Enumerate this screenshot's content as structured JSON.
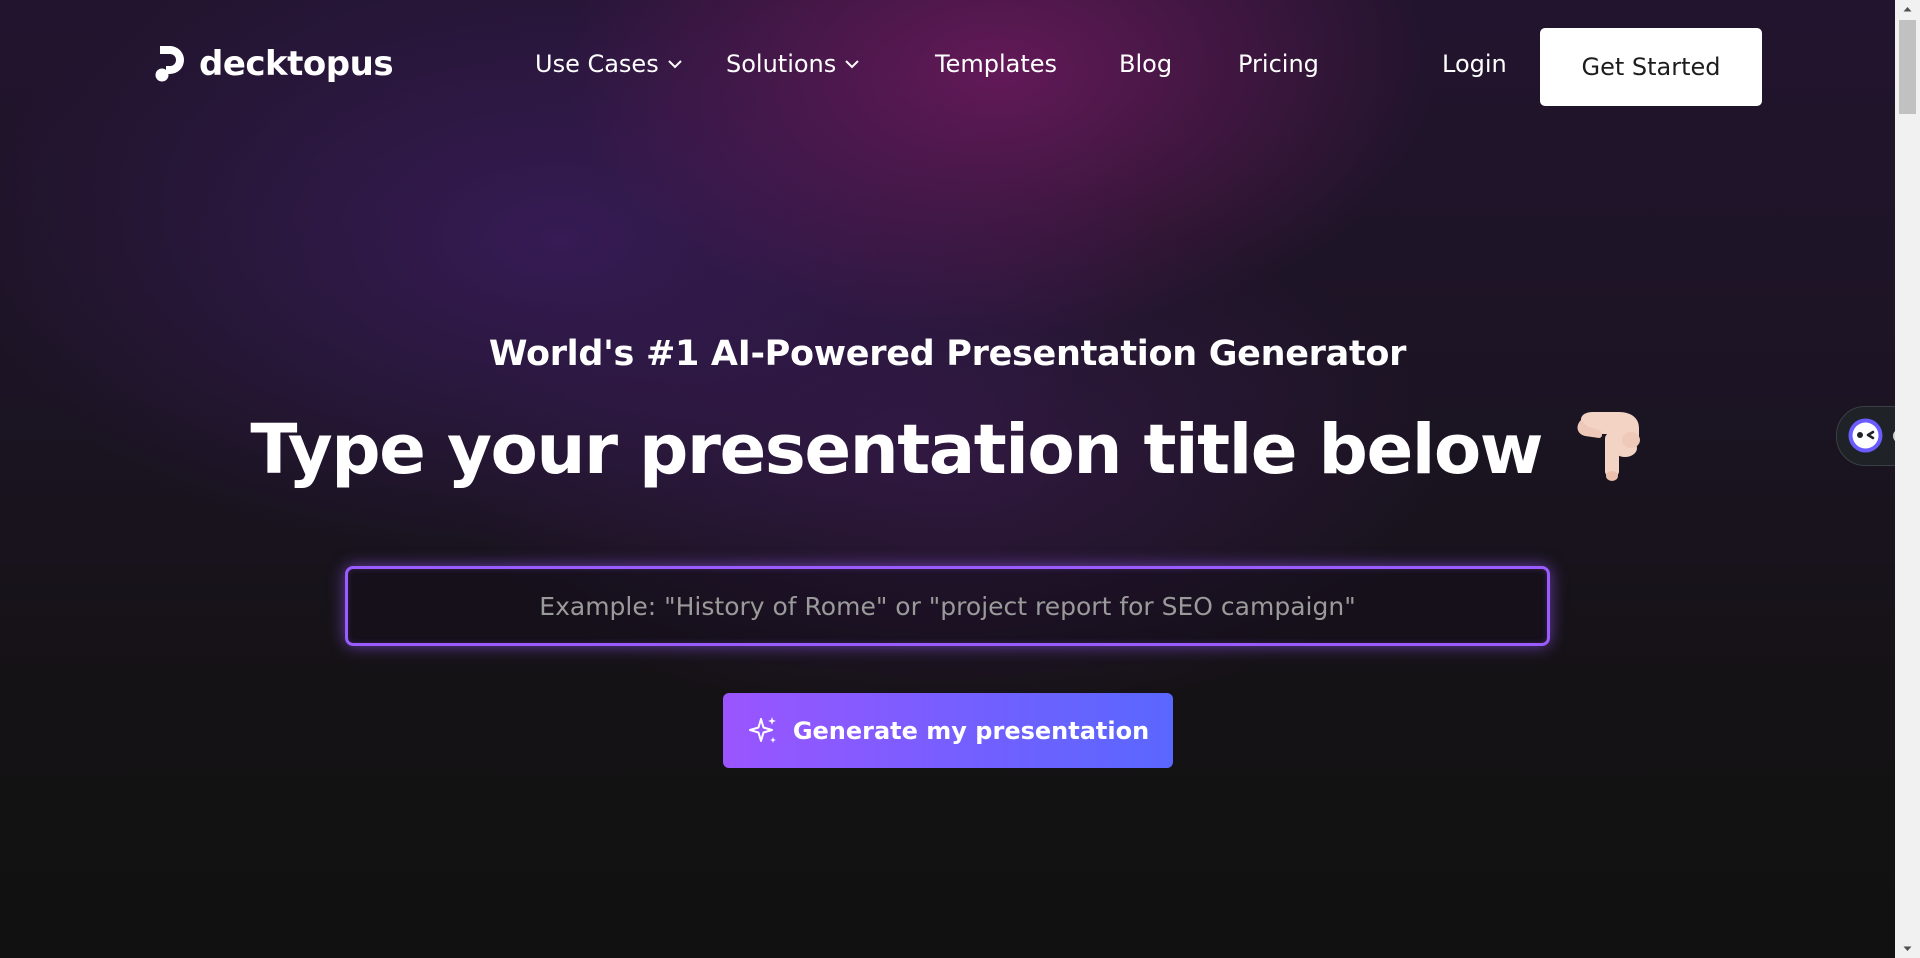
{
  "header": {
    "logo_text": "decktopus",
    "nav": {
      "use_cases": "Use Cases",
      "solutions": "Solutions",
      "templates": "Templates",
      "blog": "Blog",
      "pricing": "Pricing"
    },
    "login": "Login",
    "get_started": "Get Started"
  },
  "hero": {
    "subtitle": "World's #1 AI-Powered Presentation Generator",
    "headline": "Type your presentation title below",
    "headline_emoji": "pointing-down-hand-icon",
    "input": {
      "value": "",
      "placeholder": "Example: \"History of Rome\" or \"project report for SEO campaign\""
    },
    "generate_button": "Generate my presentation"
  },
  "colors": {
    "accent": "#9b5cff",
    "button_gradient_start": "#9b55ff",
    "button_gradient_end": "#5a67ff",
    "text": "#ffffff"
  }
}
